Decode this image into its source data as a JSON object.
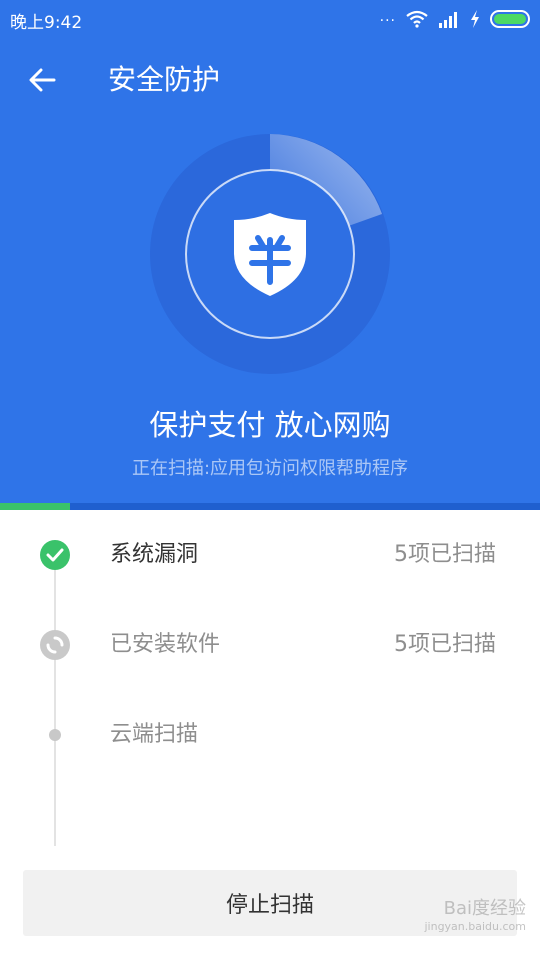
{
  "status_bar": {
    "time": "晚上9:42",
    "more": "...",
    "battery_color": "#4cd964"
  },
  "header": {
    "title": "安全防护",
    "back_icon": "arrow-left-icon"
  },
  "shield": {
    "icon": "shield-icon",
    "accent": "#2f74e8"
  },
  "slogan": "保护支付 放心网购",
  "scan_status": "正在扫描:应用包访问权限帮助程序",
  "progress": {
    "fraction": 0.13,
    "color": "#3ac26a"
  },
  "items": [
    {
      "label": "系统漏洞",
      "count": "5项已扫描",
      "state": "done",
      "icon": "check-circle-icon"
    },
    {
      "label": "已安装软件",
      "count": "5项已扫描",
      "state": "scanning",
      "icon": "loading-icon"
    },
    {
      "label": "云端扫描",
      "count": "",
      "state": "pending",
      "icon": "dot-icon"
    }
  ],
  "stop_button": "停止扫描",
  "watermark": {
    "text": "Bai度经验",
    "sub": "jingyan.baidu.com"
  },
  "colors": {
    "primary": "#2f74e8",
    "success": "#3ac26a"
  }
}
